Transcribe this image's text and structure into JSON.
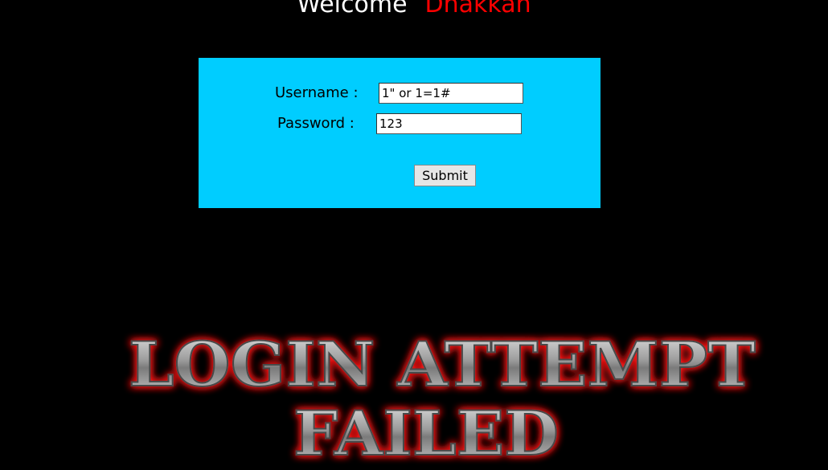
{
  "header": {
    "welcome_text": "Welcome",
    "user_name": "Dhakkan"
  },
  "login_form": {
    "username_label": "Username :",
    "username_value": "1\" or 1=1#",
    "password_label": "Password :",
    "password_value": "123",
    "submit_label": "Submit"
  },
  "result_image": {
    "line1": "LOGIN ATTEMPT",
    "line2": "FAILED"
  },
  "colors": {
    "background": "#000000",
    "panel": "#00cdff",
    "welcome": "#ffffff",
    "user_name": "#ff0000",
    "glow": "#ff1a1a",
    "metal": "#c8c8c8"
  }
}
